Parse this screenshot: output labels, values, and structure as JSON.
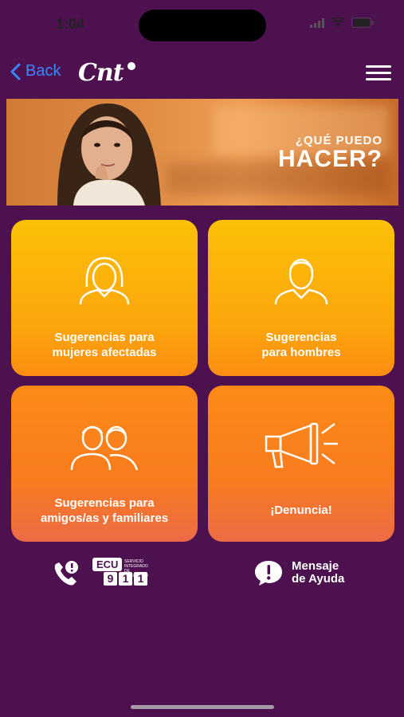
{
  "status_bar": {
    "time": "1:04"
  },
  "nav": {
    "back_label": "Back",
    "logo_text": "Cnt"
  },
  "banner": {
    "line1": "¿QUÉ PUEDO",
    "line2": "HACER?"
  },
  "cards": [
    {
      "line1": "Sugerencias para",
      "line2": "mujeres afectadas",
      "icon": "woman-icon"
    },
    {
      "line1": "Sugerencias",
      "line2": "para hombres",
      "icon": "man-icon"
    },
    {
      "line1": "Sugerencias para",
      "line2": "amigos/as y familiares",
      "icon": "group-icon"
    },
    {
      "line1": "¡Denuncia!",
      "line2": "",
      "icon": "megaphone-icon"
    }
  ],
  "footer": {
    "ecu_label": "ECU",
    "ecu_subtitle": "SERVICIO INTEGRADO DE SEGURIDAD",
    "ecu_digits": [
      "9",
      "1",
      "1"
    ],
    "help_line1": "Mensaje",
    "help_line2": "de Ayuda"
  },
  "colors": {
    "background": "#4e1150",
    "card_yellow": "#fbc108",
    "card_orange": "#fb8b16",
    "back_blue": "#3a87ff"
  }
}
